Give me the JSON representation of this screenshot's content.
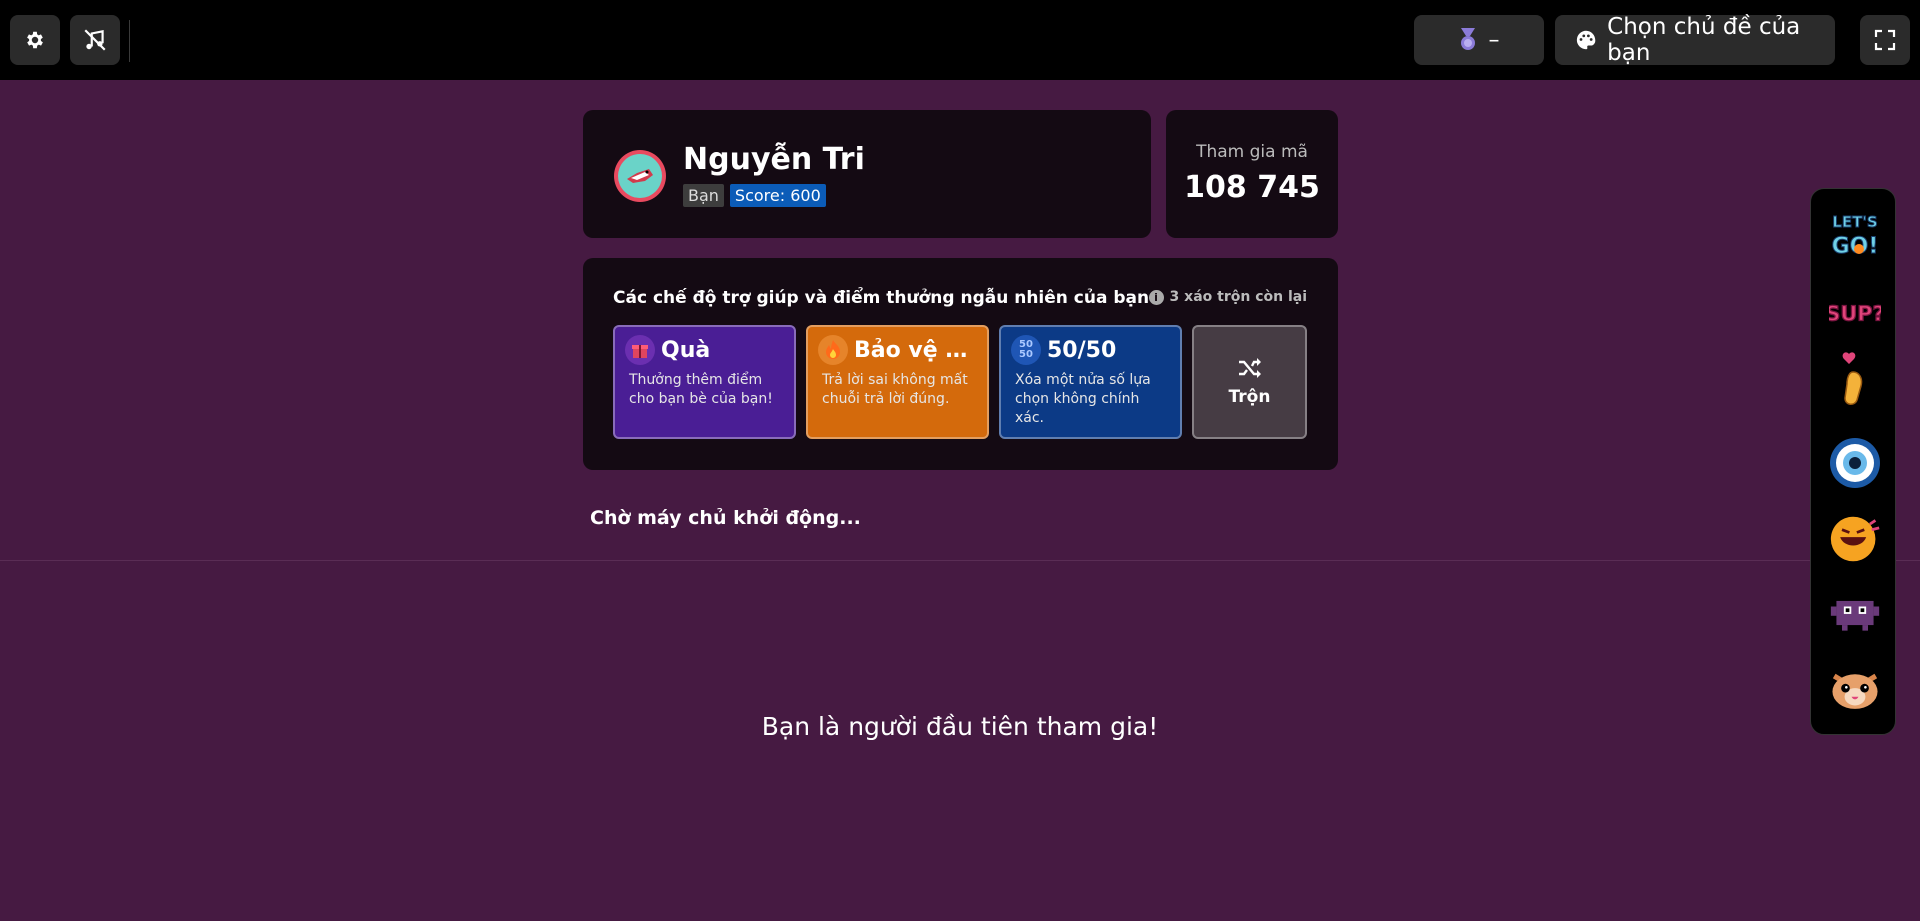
{
  "topbar": {
    "settings_icon": "gear-icon",
    "mute_icon": "music-off-icon",
    "medal_icon": "medal-icon",
    "medal_value": "–",
    "theme_icon": "palette-icon",
    "theme_label": "Chọn chủ đề của bạn",
    "fullscreen_icon": "fullscreen-icon"
  },
  "player": {
    "name": "Nguyễn Tri",
    "you_badge": "Bạn",
    "score_badge": "Score: 600"
  },
  "join": {
    "label": "Tham gia mã",
    "code": "108 745"
  },
  "powerups": {
    "title": "Các chế độ trợ giúp và điểm thưởng ngẫu nhiên của bạn",
    "shuffles_left": "3 xáo trộn còn lại",
    "items": [
      {
        "name": "Quà",
        "desc": "Thưởng thêm điểm cho bạn bè của bạn!",
        "icon": "gift-icon",
        "color": "#4a1e95"
      },
      {
        "name": "Bảo vệ ch...",
        "desc": "Trả lời sai không mất chuỗi trả lời đúng.",
        "icon": "flame-icon",
        "color": "#d46a0c"
      },
      {
        "name": "50/50",
        "desc": "Xóa một nửa số lựa chọn không chính xác.",
        "icon": "fifty-fifty-icon",
        "icon_text": "50 50",
        "color": "#0c3a86"
      }
    ],
    "shuffle_label": "Trộn",
    "shuffle_icon": "shuffle-icon"
  },
  "status": {
    "waiting": "Chờ máy chủ khởi động...",
    "first_player": "Bạn là người đầu tiên tham gia!"
  },
  "stickers": [
    {
      "name": "lets-go-sticker",
      "text": "LET'S GO!"
    },
    {
      "name": "sup-sticker",
      "text": "SUP?"
    },
    {
      "name": "finger-heart-sticker"
    },
    {
      "name": "eye-sticker"
    },
    {
      "name": "laughing-face-sticker"
    },
    {
      "name": "pixel-monster-sticker"
    },
    {
      "name": "cat-face-sticker"
    }
  ]
}
